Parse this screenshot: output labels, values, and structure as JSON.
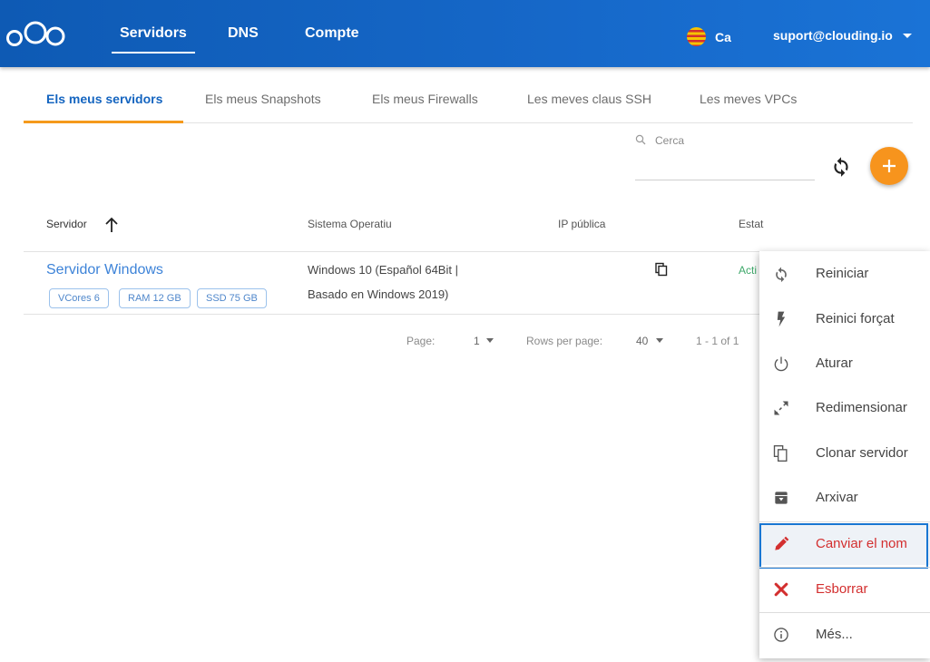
{
  "header": {
    "logo": "clouding-logo-icon",
    "nav": [
      "Servidors",
      "DNS",
      "Compte"
    ],
    "language": "Ca",
    "language_flag": "catalonia-flag-icon",
    "user_email": "suport@clouding.io"
  },
  "tabs": [
    "Els meus servidors",
    "Els meus Snapshots",
    "Els meus Firewalls",
    "Les meves claus SSH",
    "Les meves VPCs"
  ],
  "toolbar": {
    "search_placeholder": "Cerca"
  },
  "table": {
    "columns": [
      "Servidor",
      "Sistema Operatiu",
      "IP pública",
      "Estat"
    ],
    "rows": [
      {
        "name": "Servidor Windows",
        "chips": [
          "VCores 6",
          "RAM 12 GB",
          "SSD 75 GB"
        ],
        "os_line1": "Windows 10 (Español 64Bit |",
        "os_line2": "Basado en Windows 2019)",
        "status": "Acti"
      }
    ]
  },
  "pagination": {
    "page_label": "Page:",
    "page_value": "1",
    "rows_label": "Rows per page:",
    "rows_value": "40",
    "range": "1 - 1 of 1"
  },
  "context_menu": {
    "items": [
      {
        "label": "Reiniciar",
        "icon": "restart-icon"
      },
      {
        "label": "Reinici forçat",
        "icon": "lightning-bolt-icon"
      },
      {
        "label": "Aturar",
        "icon": "power-icon"
      },
      {
        "label": "Redimensionar",
        "icon": "resize-icon"
      },
      {
        "label": "Clonar servidor",
        "icon": "clone-icon"
      },
      {
        "label": "Arxivar",
        "icon": "archive-icon"
      },
      {
        "label": "Canviar el nom",
        "icon": "pencil-icon"
      },
      {
        "label": "Esborrar",
        "icon": "close-x-icon"
      },
      {
        "label": "Més...",
        "icon": "info-icon"
      }
    ]
  },
  "colors": {
    "header": "#1668c9",
    "accent": "#f7941d",
    "link": "#3d83d8",
    "danger": "#d32f2f",
    "status_active": "#3ea86a"
  }
}
